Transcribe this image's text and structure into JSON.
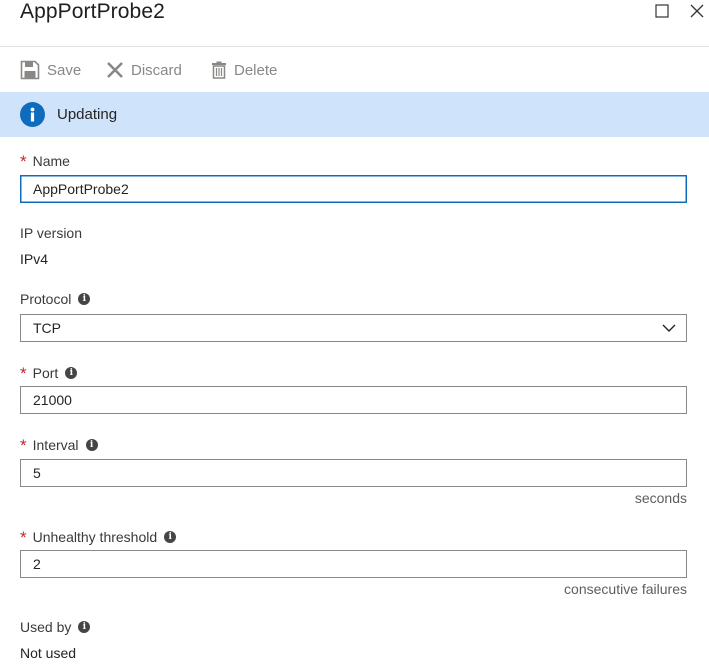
{
  "header": {
    "title": "AppPortProbe2"
  },
  "toolbar": {
    "save_label": "Save",
    "discard_label": "Discard",
    "delete_label": "Delete"
  },
  "banner": {
    "text": "Updating"
  },
  "form": {
    "name": {
      "label": "Name",
      "value": "AppPortProbe2"
    },
    "ip_version": {
      "label": "IP version",
      "value": "IPv4"
    },
    "protocol": {
      "label": "Protocol",
      "value": "TCP"
    },
    "port": {
      "label": "Port",
      "value": "21000"
    },
    "interval": {
      "label": "Interval",
      "value": "5",
      "unit": "seconds"
    },
    "unhealthy_threshold": {
      "label": "Unhealthy threshold",
      "value": "2",
      "unit": "consecutive failures"
    },
    "used_by": {
      "label": "Used by",
      "value": "Not used"
    }
  },
  "icons": {
    "info_banner": "info-circle-icon",
    "info_tooltip": "info-icon",
    "save": "save-icon",
    "discard": "discard-icon",
    "delete": "delete-icon",
    "maximize": "maximize-icon",
    "close": "close-icon",
    "dropdown": "chevron-down-icon"
  },
  "colors": {
    "banner_bg": "#cfe3fb",
    "accent": "#0f6cbd",
    "required": "#c4262e"
  }
}
